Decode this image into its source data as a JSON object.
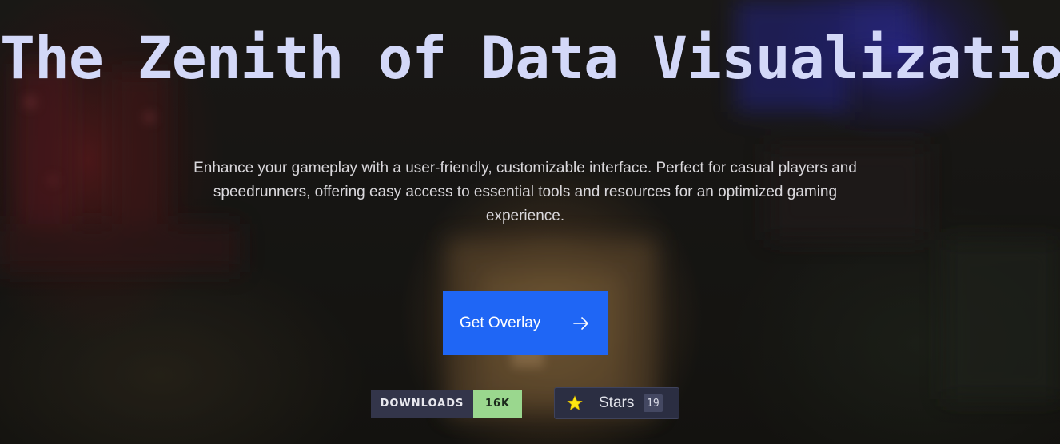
{
  "hero": {
    "title": "The Zenith of Data Visualization",
    "subtitle": "Enhance your gameplay with a user-friendly, customizable interface. Perfect for casual players and speedrunners, offering easy access to essential tools and resources for an optimized gaming experience.",
    "cta_label": "Get Overlay",
    "cta_icon": "arrow-right-icon"
  },
  "badges": {
    "downloads_label": "DOWNLOADS",
    "downloads_value": "16K",
    "downloads_label_color": "#33354a",
    "downloads_value_color": "#9ad78e"
  },
  "stars": {
    "icon": "star-icon",
    "label": "Stars",
    "count": "19"
  },
  "colors": {
    "title": "#d3d8f8",
    "accent": "#1f66f5",
    "star": "#ffe812"
  }
}
